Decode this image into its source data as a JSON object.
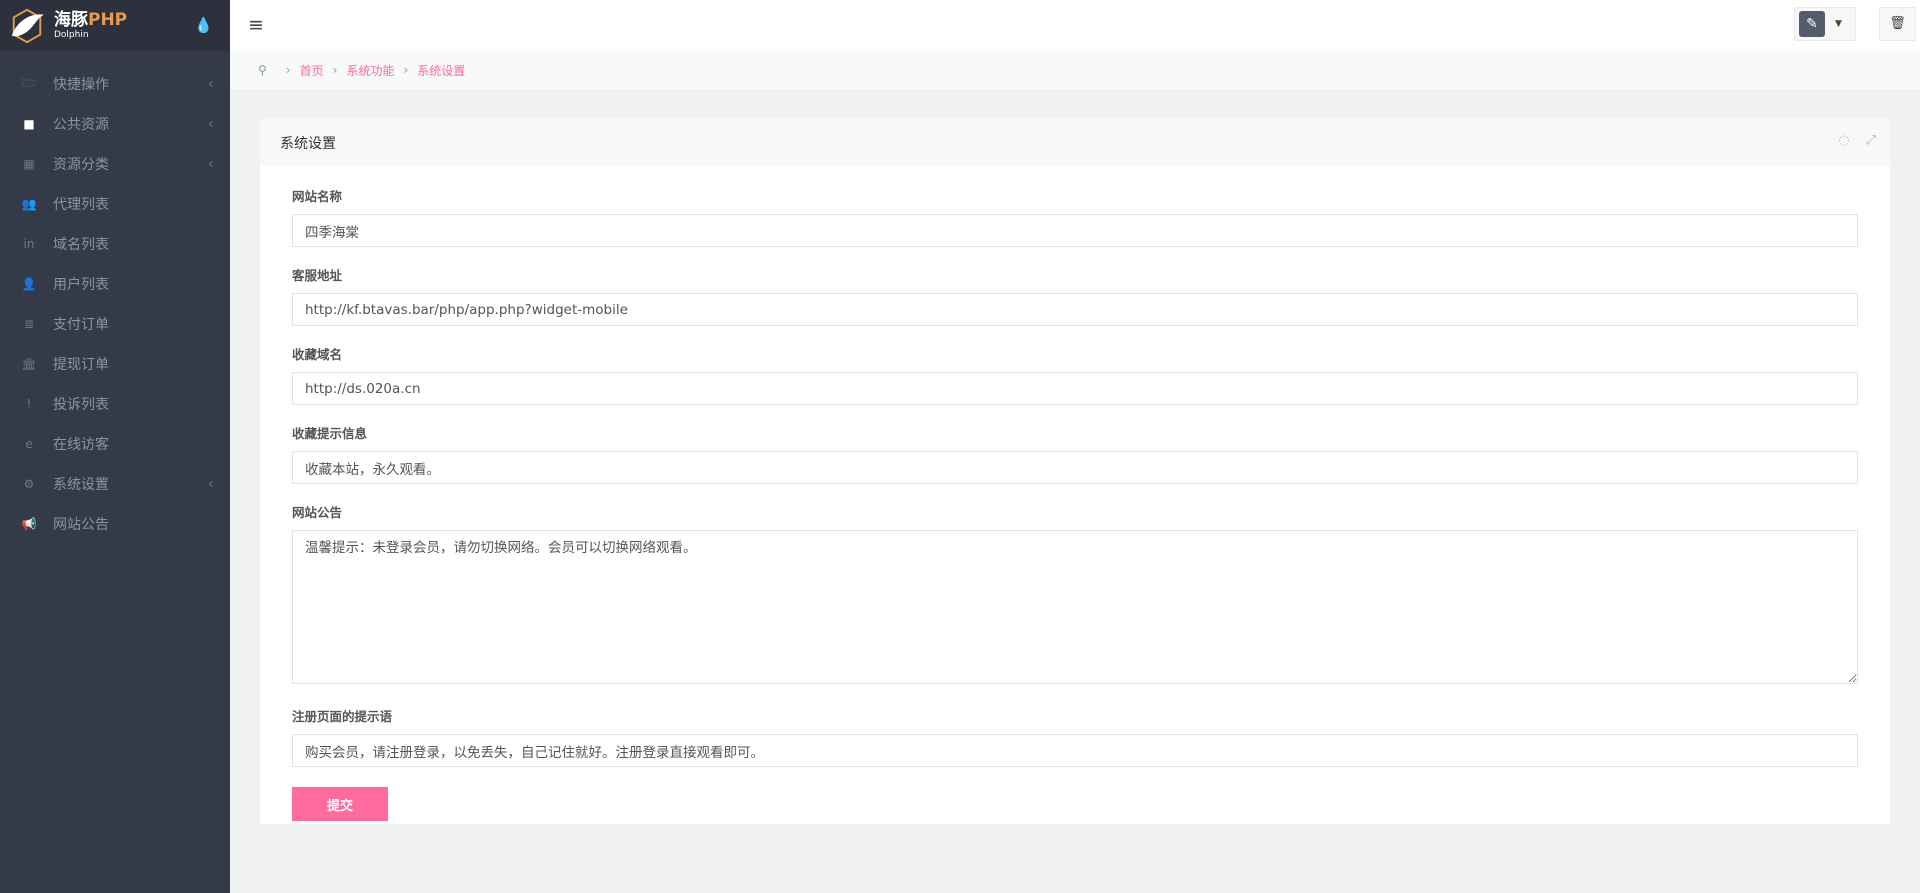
{
  "brand": {
    "name_cn": "海豚",
    "name_php": "PHP",
    "sub": "Dolphin"
  },
  "sidebar": {
    "items": [
      {
        "label": "快捷操作",
        "icon": "folder-open-icon",
        "glyph": "🗁",
        "chev": true
      },
      {
        "label": "公共资源",
        "icon": "video-camera-icon",
        "glyph": "■",
        "chev": true
      },
      {
        "label": "资源分类",
        "icon": "grid-icon",
        "glyph": "▦",
        "chev": true
      },
      {
        "label": "代理列表",
        "icon": "users-icon",
        "glyph": "👥",
        "chev": false
      },
      {
        "label": "域名列表",
        "icon": "linkedin-icon",
        "glyph": "in",
        "chev": false
      },
      {
        "label": "用户列表",
        "icon": "user-icon",
        "glyph": "👤",
        "chev": false
      },
      {
        "label": "支付订单",
        "icon": "database-icon",
        "glyph": "≣",
        "chev": false
      },
      {
        "label": "提现订单",
        "icon": "bank-icon",
        "glyph": "🏛",
        "chev": false
      },
      {
        "label": "投诉列表",
        "icon": "exclamation-circle-icon",
        "glyph": "!",
        "chev": false
      },
      {
        "label": "在线访客",
        "icon": "edge-icon",
        "glyph": "e",
        "chev": false
      },
      {
        "label": "系统设置",
        "icon": "gear-icon",
        "glyph": "⚙",
        "chev": true
      },
      {
        "label": "网站公告",
        "icon": "bullhorn-icon",
        "glyph": "📢",
        "chev": false
      }
    ]
  },
  "breadcrumb": [
    "首页",
    "系统功能",
    "系统设置"
  ],
  "panel": {
    "title": "系统设置"
  },
  "form": {
    "fields": [
      {
        "label": "网站名称",
        "value": "四季海棠"
      },
      {
        "label": "客服地址",
        "value": "http://kf.btavas.bar/php/app.php?widget-mobile"
      },
      {
        "label": "收藏域名",
        "value": "http://ds.020a.cn"
      },
      {
        "label": "收藏提示信息",
        "value": "收藏本站，永久观看。"
      },
      {
        "label": "网站公告",
        "value": "温馨提示：未登录会员，请勿切换网络。会员可以切换网络观看。"
      },
      {
        "label": "注册页面的提示语",
        "value": "购买会员，请注册登录，以免丢失，自己记住就好。注册登录直接观看即可。"
      }
    ],
    "submit": "提交"
  },
  "colors": {
    "accent": "#ff6b9b",
    "sidebar": "#343a48"
  }
}
